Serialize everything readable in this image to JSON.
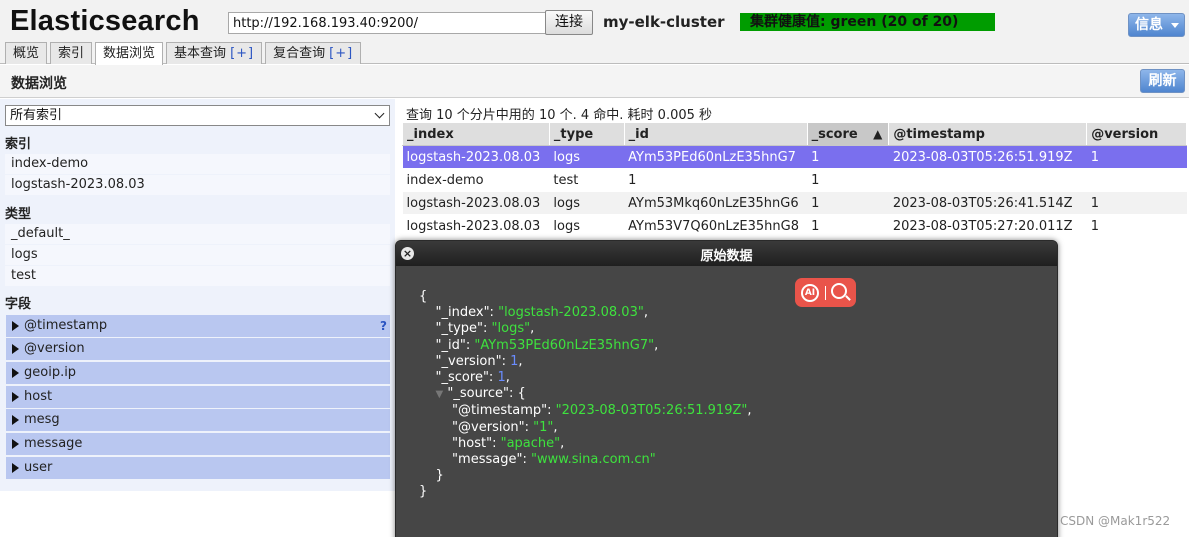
{
  "header": {
    "title": "Elasticsearch",
    "url_value": "http://192.168.193.40:9200/",
    "connect_label": "连接",
    "cluster_name": "my-elk-cluster",
    "health": "集群健康值: green (20 of 20)",
    "info_label": "信息",
    "tabs": [
      {
        "label": "概览",
        "plus": ""
      },
      {
        "label": "索引",
        "plus": ""
      },
      {
        "label": "数据浏览",
        "plus": ""
      },
      {
        "label": "基本查询",
        "plus": "[+]"
      },
      {
        "label": "复合查询",
        "plus": "[+]"
      }
    ],
    "active_tab": "数据浏览"
  },
  "section": {
    "title": "数据浏览",
    "refresh_label": "刷新"
  },
  "sidebar": {
    "index_select": "所有索引",
    "indices_heading": "索引",
    "indices": [
      "index-demo",
      "logstash-2023.08.03"
    ],
    "types_heading": "类型",
    "types": [
      "_default_",
      "logs",
      "test"
    ],
    "fields_heading": "字段",
    "fields": [
      "@timestamp",
      "@version",
      "geoip.ip",
      "host",
      "mesg",
      "message",
      "user"
    ],
    "help_mark": "?"
  },
  "results": {
    "query_info": "查询 10 个分片中用的 10 个. 4 命中. 耗时 0.005 秒",
    "columns": [
      "_index",
      "_type",
      "_id",
      "_score",
      "@timestamp",
      "@version"
    ],
    "sort_indicator": "▲",
    "rows": [
      [
        "logstash-2023.08.03",
        "logs",
        "AYm53PEd60nLzE35hnG7",
        "1",
        "2023-08-03T05:26:51.919Z",
        "1"
      ],
      [
        "index-demo",
        "test",
        "1",
        "1",
        "",
        ""
      ],
      [
        "logstash-2023.08.03",
        "logs",
        "AYm53Mkq60nLzE35hnG6",
        "1",
        "2023-08-03T05:26:41.514Z",
        "1"
      ],
      [
        "logstash-2023.08.03",
        "logs",
        "AYm53V7Q60nLzE35hnG8",
        "1",
        "2023-08-03T05:27:20.011Z",
        "1"
      ]
    ]
  },
  "dialog": {
    "title": "原始数据",
    "close_glyph": "×",
    "ai_badge_text": "AI",
    "source": {
      "_index": "logstash-2023.08.03",
      "_type": "logs",
      "_id": "AYm53PEd60nLzE35hnG7",
      "_version": "1",
      "_score": "1",
      "@timestamp": "2023-08-03T05:26:51.919Z",
      "@version": "1",
      "host": "apache",
      "message": "www.sina.com.cn"
    }
  },
  "watermark": "CSDN @Mak1r522",
  "colors": {
    "health_green": "#009c00",
    "selected_row": "#7a6fee",
    "field_bg": "#b9c7f0",
    "json_string": "#3ee23e",
    "json_number": "#6a8cff",
    "button_blue": "#4f85cf"
  },
  "icons": {
    "close": "close-icon",
    "expand_triangle": "triangle-right-icon",
    "sort_asc": "sort-asc-icon",
    "ai_search": "ai-search-icon"
  }
}
